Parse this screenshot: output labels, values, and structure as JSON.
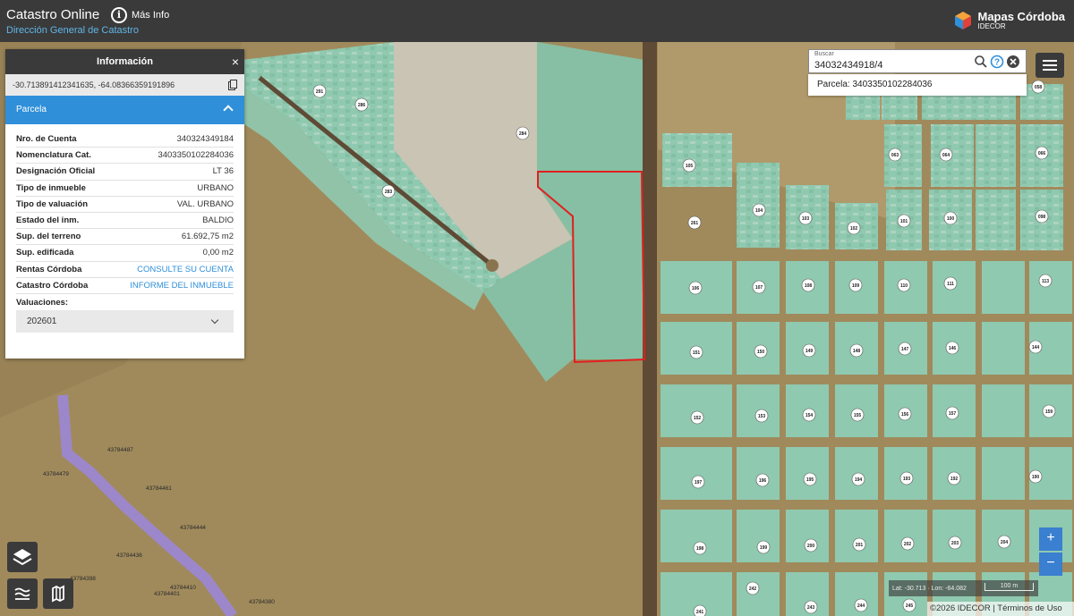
{
  "header": {
    "title": "Catastro Online",
    "subtitle": "Dirección General de Catastro",
    "info_label": "Más Info",
    "info_icon": "info-icon",
    "brand_name": "Mapas Córdoba",
    "brand_sub": "IDECOR"
  },
  "panel": {
    "title": "Información",
    "close": "×",
    "coords": "-30.713891412341635, -64.08366359191896",
    "section": "Parcela",
    "rows": [
      {
        "key": "Nro. de Cuenta",
        "value": "340324349184"
      },
      {
        "key": "Nomenclatura Cat.",
        "value": "3403350102284036"
      },
      {
        "key": "Designación Oficial",
        "value": "LT 36"
      },
      {
        "key": "Tipo de inmueble",
        "value": "URBANO"
      },
      {
        "key": "Tipo de valuación",
        "value": "VAL. URBANO"
      },
      {
        "key": "Estado del inm.",
        "value": "BALDIO"
      },
      {
        "key": "Sup. del terreno",
        "value": "61.692,75 m2"
      },
      {
        "key": "Sup. edificada",
        "value": "0,00 m2"
      },
      {
        "key": "Rentas Córdoba",
        "value": "CONSULTE SU CUENTA"
      },
      {
        "key": "Catastro Córdoba",
        "value": "INFORME DEL INMUEBLE"
      }
    ],
    "valuaciones_label": "Valuaciones:",
    "valuaciones_selected": "202601"
  },
  "search": {
    "label": "Buscar",
    "value": "34032434918/4",
    "suggestion": "Parcela: 3403350102284036"
  },
  "map": {
    "scale_coords": "Lat: -30.713 · Lon: -64.082",
    "scale_label": "100 m",
    "attribution": "©2026 IDECOR | Términos de Uso",
    "zoom_in": "+",
    "zoom_out": "−",
    "colors": {
      "terrain": "#a08a5c",
      "parcel": "#8fc9b0",
      "road": "#5e4a35",
      "selected": "#e02020",
      "river": "#9b86d6"
    },
    "parcel_labels": [
      {
        "text": "291"
      },
      {
        "text": "286"
      },
      {
        "text": "284"
      },
      {
        "text": "283"
      },
      {
        "text": "105"
      },
      {
        "text": "104"
      },
      {
        "text": "103"
      },
      {
        "text": "102"
      },
      {
        "text": "101"
      },
      {
        "text": "100"
      },
      {
        "text": "098"
      },
      {
        "text": "261"
      },
      {
        "text": "063"
      },
      {
        "text": "064"
      },
      {
        "text": "066"
      },
      {
        "text": "058"
      },
      {
        "text": "106"
      },
      {
        "text": "107"
      },
      {
        "text": "108"
      },
      {
        "text": "109"
      },
      {
        "text": "110"
      },
      {
        "text": "111"
      },
      {
        "text": "113"
      },
      {
        "text": "151"
      },
      {
        "text": "150"
      },
      {
        "text": "149"
      },
      {
        "text": "148"
      },
      {
        "text": "147"
      },
      {
        "text": "146"
      },
      {
        "text": "144"
      },
      {
        "text": "152"
      },
      {
        "text": "153"
      },
      {
        "text": "154"
      },
      {
        "text": "155"
      },
      {
        "text": "156"
      },
      {
        "text": "157"
      },
      {
        "text": "159"
      },
      {
        "text": "197"
      },
      {
        "text": "196"
      },
      {
        "text": "195"
      },
      {
        "text": "194"
      },
      {
        "text": "193"
      },
      {
        "text": "192"
      },
      {
        "text": "190"
      },
      {
        "text": "198"
      },
      {
        "text": "199"
      },
      {
        "text": "200"
      },
      {
        "text": "201"
      },
      {
        "text": "202"
      },
      {
        "text": "203"
      },
      {
        "text": "204"
      },
      {
        "text": "241"
      },
      {
        "text": "242"
      },
      {
        "text": "243"
      },
      {
        "text": "244"
      },
      {
        "text": "245"
      }
    ],
    "account_labels": [
      "43784487",
      "43784479",
      "43784461",
      "43784444",
      "43784436",
      "43784398",
      "43784410",
      "43784401",
      "43784380"
    ]
  }
}
